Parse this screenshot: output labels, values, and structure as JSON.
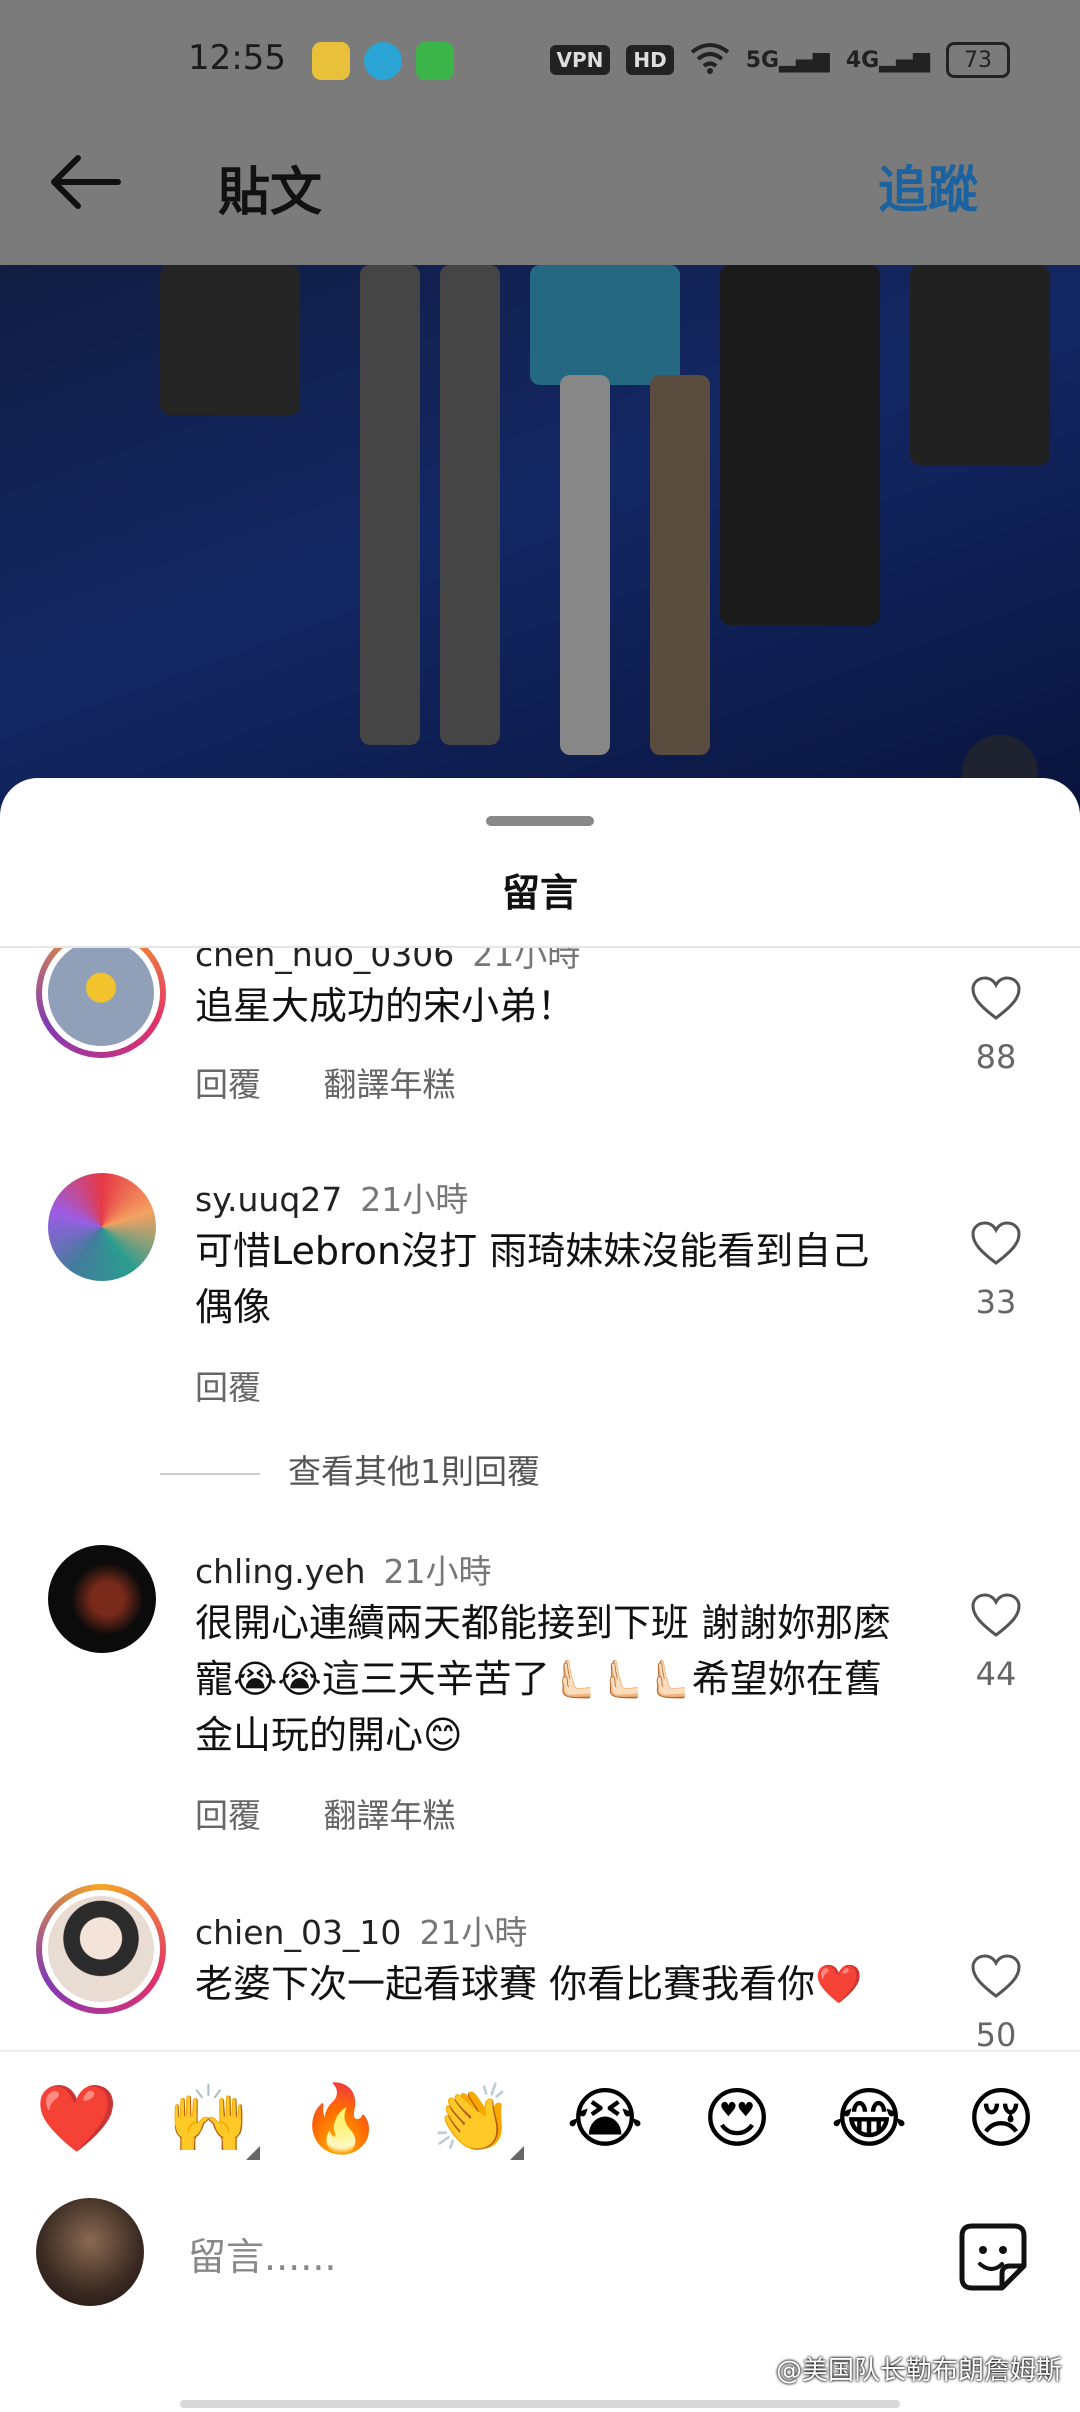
{
  "status_bar": {
    "time": "12:55",
    "vpn": "VPN",
    "hd": "HD",
    "net1": "5G",
    "net2": "4G",
    "battery": "73"
  },
  "nav": {
    "title": "貼文",
    "follow_label": "追蹤"
  },
  "sheet": {
    "title": "留言"
  },
  "comments": [
    {
      "username": "chen_nuo_0306",
      "time": "21小時",
      "text": "追星大成功的宋小弟！",
      "actions": [
        "回覆",
        "翻譯年糕"
      ],
      "likes": "88"
    },
    {
      "username": "sy.uuq27",
      "time": "21小時",
      "text": "可惜Lebron沒打 雨琦妹妹沒能看到自己偶像",
      "actions": [
        "回覆"
      ],
      "likes": "33",
      "more_replies": "查看其他1則回覆"
    },
    {
      "username": "chling.yeh",
      "time": "21小時",
      "text": "很開心連續兩天都能接到下班 謝謝妳那麼寵😭😭這三天辛苦了🫷🏻🫷🏻🫷🏻希望妳在舊金山玩的開心😊",
      "actions": [
        "回覆",
        "翻譯年糕"
      ],
      "likes": "44"
    },
    {
      "username": "chien_03_10",
      "time": "21小時",
      "text": "老婆下次一起看球賽 你看比賽我看你❤️",
      "actions": [],
      "likes": "50"
    }
  ],
  "emoji_bar": [
    "❤️",
    "🙌",
    "🔥",
    "👏",
    "😭",
    "😍",
    "😂",
    "😢"
  ],
  "input": {
    "placeholder": "留言......"
  },
  "watermark": "@美国队长勒布朗詹姆斯",
  "colors": {
    "accent": "#1a63a0",
    "dim": "#7b7b7b"
  }
}
